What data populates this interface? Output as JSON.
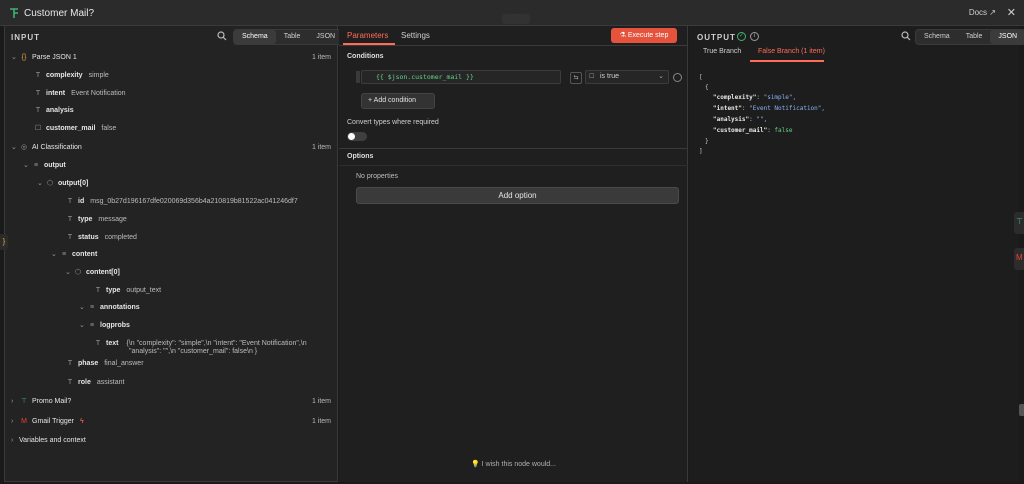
{
  "header": {
    "node_title": "Customer Mail?",
    "docs_label": "Docs",
    "close_glyph": "✕",
    "external_icon": "↗"
  },
  "input": {
    "title": "INPUT",
    "view_options": [
      "Schema",
      "Table",
      "JSON"
    ],
    "active_view": "Schema",
    "tree": [
      {
        "label": "Parse JSON 1",
        "value": "",
        "items": "1 item"
      },
      {
        "label": "complexity",
        "value": "simple"
      },
      {
        "label": "intent",
        "value": "Event Notification"
      },
      {
        "label": "analysis",
        "value": ""
      },
      {
        "label": "customer_mail",
        "value": "false"
      },
      {
        "label": "AI Classification",
        "value": "",
        "items": "1 item"
      },
      {
        "label": "output",
        "value": ""
      },
      {
        "label": "output[0]",
        "value": ""
      },
      {
        "label": "id",
        "value": "msg_0b27d196167dfe020069d356b4a210819b81522ac041246df7"
      },
      {
        "label": "type",
        "value": "message"
      },
      {
        "label": "status",
        "value": "completed"
      },
      {
        "label": "content",
        "value": ""
      },
      {
        "label": "content[0]",
        "value": ""
      },
      {
        "label": "type",
        "value": "output_text"
      },
      {
        "label": "annotations",
        "value": ""
      },
      {
        "label": "logprobs",
        "value": ""
      },
      {
        "label": "text",
        "value": "{\\n \"complexity\": \"simple\",\\n \"intent\": \"Event Notification\",\\n",
        "value2": "\"analysis\": \"\",\\n \"customer_mail\": false\\n }"
      },
      {
        "label": "phase",
        "value": "final_answer"
      },
      {
        "label": "role",
        "value": "assistant"
      },
      {
        "label": "Promo Mail?",
        "value": "",
        "items": "1 item"
      },
      {
        "label": "Gmail Trigger",
        "value": "",
        "items": "1 item"
      },
      {
        "label": "Variables and context",
        "value": ""
      }
    ]
  },
  "params": {
    "tabs": [
      "Parameters",
      "Settings"
    ],
    "active_tab": "Parameters",
    "execute_label": "Execute step",
    "conditions_label": "Conditions",
    "condition_value": "{{ $json.customer_mail }}",
    "operator": "is true",
    "add_condition_label": "+ Add condition",
    "convert_types_label": "Convert types where required",
    "options_label": "Options",
    "no_properties": "No properties",
    "add_option_label": "Add option",
    "wish_label": "I wish this node would..."
  },
  "output": {
    "title": "OUTPUT",
    "view_options": [
      "Schema",
      "Table",
      "JSON"
    ],
    "active_view": "JSON",
    "branches": [
      "True Branch",
      "False Branch (1 item)"
    ],
    "active_branch": "False Branch (1 item)",
    "json": {
      "open_bracket": "[",
      "open_brace": "{",
      "rows": [
        {
          "key": "\"complexity\"",
          "value": "\"simple\","
        },
        {
          "key": "\"intent\"",
          "value": "\"Event Notification\","
        },
        {
          "key": "\"analysis\"",
          "value": "\"\","
        },
        {
          "key": "\"customer_mail\"",
          "value": "false"
        }
      ],
      "close_brace": "}",
      "close_bracket": "]"
    }
  },
  "colors": {
    "accent": "#ff6d5a",
    "execute": "#e5533d",
    "expression": "#64d28b",
    "success": "#3cb371"
  }
}
